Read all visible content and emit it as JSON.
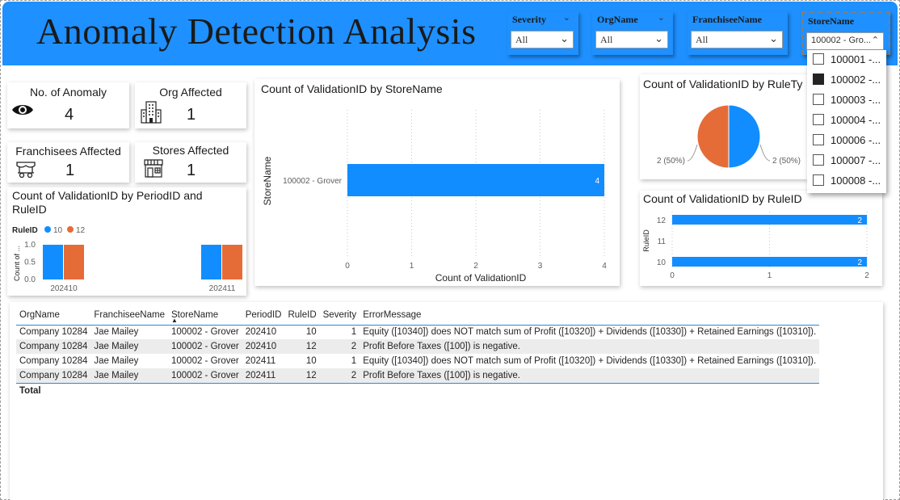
{
  "header": {
    "title": "Anomaly Detection Analysis",
    "slicers": [
      {
        "label": "Severity",
        "value": "All"
      },
      {
        "label": "OrgName",
        "value": "All"
      },
      {
        "label": "FranchiseeName",
        "value": "All"
      },
      {
        "label": "StoreName",
        "value": "100002 - Gro..."
      }
    ]
  },
  "dropdown": {
    "items": [
      {
        "label": "100001 -...",
        "checked": false
      },
      {
        "label": "100002 -...",
        "checked": true
      },
      {
        "label": "100003 -...",
        "checked": false
      },
      {
        "label": "100004 -...",
        "checked": false
      },
      {
        "label": "100006 -...",
        "checked": false
      },
      {
        "label": "100007 -...",
        "checked": false
      },
      {
        "label": "100008 -...",
        "checked": false
      }
    ]
  },
  "kpis": {
    "anomaly": {
      "title": "No. of Anomaly",
      "value": "4",
      "icon": "eye-icon"
    },
    "org": {
      "title": "Org Affected",
      "value": "1",
      "icon": "building-icon"
    },
    "franchisees": {
      "title": "Franchisees Affected",
      "value": "1",
      "icon": "cart-icon"
    },
    "stores": {
      "title": "Stores Affected",
      "value": "1",
      "icon": "store-icon"
    }
  },
  "colors": {
    "blue": "#118dff",
    "orange": "#e66c37",
    "header": "#1e90ff"
  },
  "charts": {
    "period": {
      "title": "Count of ValidationID by PeriodID and RuleID",
      "legend_title": "RuleID",
      "y_title": "Count of ..."
    },
    "store": {
      "title": "Count of ValidationID by StoreName",
      "x_title": "Count of ValidationID",
      "y_title": "StoreName"
    },
    "ruletype": {
      "title": "Count of ValidationID by RuleTy"
    },
    "rule": {
      "title": "Count of ValidationID by RuleID",
      "y_title": "RuleID"
    }
  },
  "chart_data": [
    {
      "type": "bar",
      "title": "Count of ValidationID by PeriodID and RuleID",
      "categories": [
        "202410",
        "202411"
      ],
      "series": [
        {
          "name": "10",
          "values": [
            1,
            1
          ]
        },
        {
          "name": "12",
          "values": [
            1,
            1
          ]
        }
      ],
      "legend_title": "RuleID",
      "ylabel": "Count of ...",
      "ylim": [
        0,
        1
      ],
      "yticks": [
        "0.0",
        "0.5",
        "1.0"
      ],
      "legend": "top-left"
    },
    {
      "type": "bar",
      "orientation": "horizontal",
      "title": "Count of ValidationID by StoreName",
      "categories": [
        "100002 - Grover"
      ],
      "values": [
        4
      ],
      "xlabel": "Count of ValidationID",
      "ylabel": "StoreName",
      "xlim": [
        0,
        4
      ],
      "xticks": [
        "0",
        "1",
        "2",
        "3",
        "4"
      ],
      "data_labels": [
        "4"
      ]
    },
    {
      "type": "pie",
      "title": "Count of ValidationID by RuleTy",
      "values": [
        2,
        2
      ],
      "data_labels": [
        "2 (50%)",
        "2 (50%)"
      ]
    },
    {
      "type": "bar",
      "orientation": "horizontal",
      "title": "Count of ValidationID by RuleID",
      "categories": [
        "12",
        "11",
        "10"
      ],
      "values": [
        2,
        0,
        2
      ],
      "ylabel": "RuleID",
      "xlim": [
        0,
        2
      ],
      "xticks": [
        "0",
        "1",
        "2"
      ],
      "data_labels": [
        "2",
        "",
        "2"
      ]
    }
  ],
  "table": {
    "columns": [
      "OrgName",
      "FranchiseeName",
      "StoreName",
      "PeriodID",
      "RuleID",
      "Severity",
      "ErrorMessage"
    ],
    "rows": [
      [
        "Company 10284",
        "Jae Mailey",
        "100002 - Grover",
        "202410",
        "10",
        "1",
        "Equity ([10340]) does NOT match sum of Profit ([10320]) + Dividends ([10330]) + Retained Earnings ([10310])."
      ],
      [
        "Company 10284",
        "Jae Mailey",
        "100002 - Grover",
        "202410",
        "12",
        "2",
        "Profit Before Taxes ([100]) is negative."
      ],
      [
        "Company 10284",
        "Jae Mailey",
        "100002 - Grover",
        "202411",
        "10",
        "1",
        "Equity ([10340]) does NOT match sum of Profit ([10320]) + Dividends ([10330]) + Retained Earnings ([10310])."
      ],
      [
        "Company 10284",
        "Jae Mailey",
        "100002 - Grover",
        "202411",
        "12",
        "2",
        "Profit Before Taxes ([100]) is negative."
      ]
    ],
    "total_label": "Total"
  }
}
